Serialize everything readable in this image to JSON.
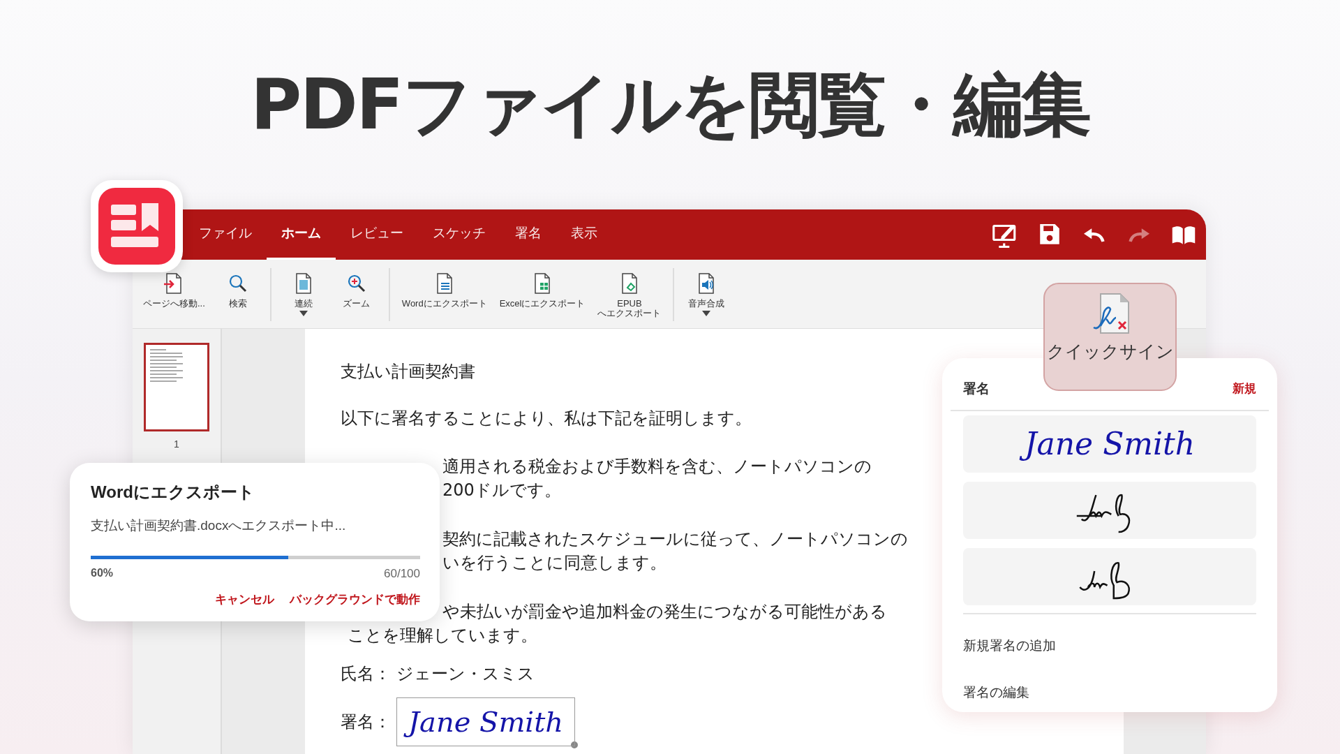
{
  "headline": "PDFファイルを閲覧・編集",
  "menu_tabs": [
    {
      "label": "ファイル",
      "selected": false
    },
    {
      "label": "ホーム",
      "selected": true
    },
    {
      "label": "レビュー",
      "selected": false
    },
    {
      "label": "スケッチ",
      "selected": false
    },
    {
      "label": "署名",
      "selected": false
    },
    {
      "label": "表示",
      "selected": false
    }
  ],
  "title_bar_icons": [
    {
      "kind": "annotate",
      "disabled": false
    },
    {
      "kind": "save",
      "disabled": false
    },
    {
      "kind": "undo",
      "disabled": false
    },
    {
      "kind": "redo",
      "disabled": true
    },
    {
      "kind": "book",
      "disabled": false
    }
  ],
  "toolbar_groups": [
    [
      {
        "label": "ページへ移動...",
        "kind": "goto",
        "dropdown": false
      },
      {
        "label": "検索",
        "kind": "search",
        "dropdown": false
      }
    ],
    [
      {
        "label": "連続",
        "kind": "continuous",
        "dropdown": true
      },
      {
        "label": "ズーム",
        "kind": "zoom",
        "dropdown": false
      }
    ],
    [
      {
        "label": "Wordにエクスポート",
        "kind": "word",
        "dropdown": false
      },
      {
        "label": "Excelにエクスポート",
        "kind": "excel",
        "dropdown": false
      },
      {
        "label": "EPUB\nへエクスポート",
        "kind": "epub",
        "dropdown": false
      }
    ],
    [
      {
        "label": "音声合成",
        "kind": "speech",
        "dropdown": true
      }
    ]
  ],
  "thumbnails": [
    {
      "page": "1",
      "selected": true
    }
  ],
  "document": {
    "title": "支払い計画契約書",
    "intro": "以下に署名することにより、私は下記を証明します。",
    "clauses": [
      [
        "適用される税金および手数料を含む、ノートパソコンの",
        "200ドルです。"
      ],
      [
        "契約に記載されたスケジュールに従って、ノートパソコンの",
        "いを行うことに同意します。"
      ],
      [
        "や未払いが罰金や追加料金の発生につながる可能性がある",
        "ことを理解しています。"
      ]
    ],
    "name_label": "氏名：",
    "name_value": "ジェーン・スミス",
    "signature_label": "署名：",
    "signature_value": "Jane Smith"
  },
  "export_dialog": {
    "title": "Wordにエクスポート",
    "message": "支払い計画契約書.docxへエクスポート中...",
    "level": 0.6,
    "percent": "60%",
    "count": "60/100",
    "buttons": [
      "キャンセル",
      "バックグラウンドで動作"
    ]
  },
  "quick_sign": {
    "label": "クイックサイン"
  },
  "signature_panel": {
    "title": "署名",
    "new_button": "新規",
    "signatures": [
      {
        "kind": "typed",
        "text": "Jane Smith"
      },
      {
        "kind": "drawn"
      },
      {
        "kind": "drawn"
      }
    ],
    "actions": [
      "新規署名の追加",
      "署名の編集"
    ]
  }
}
